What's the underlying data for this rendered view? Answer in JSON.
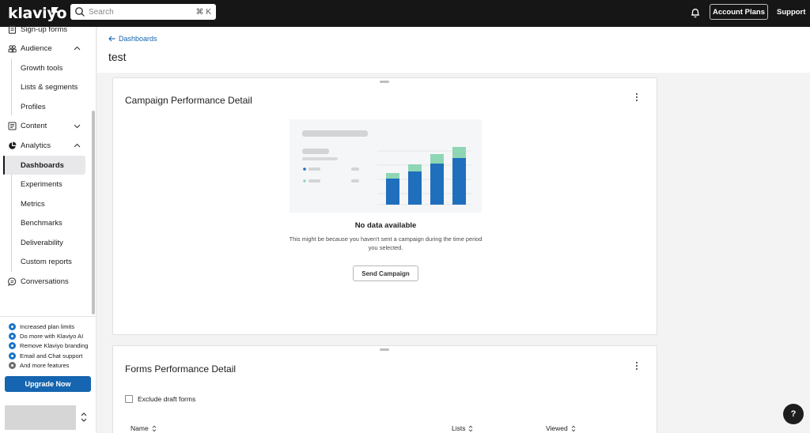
{
  "topbar": {
    "logo": "klaviyo",
    "search_placeholder": "Search",
    "search_shortcut": "⌘ K",
    "account_plans": "Account Plans",
    "support": "Support"
  },
  "sidebar": {
    "items": [
      {
        "label": "Sign-up forms",
        "icon": "form-icon"
      },
      {
        "label": "Audience",
        "icon": "people-icon",
        "expanded": true
      },
      {
        "label": "Content",
        "icon": "content-icon",
        "expanded": false
      },
      {
        "label": "Analytics",
        "icon": "pie-chart-icon",
        "expanded": true
      },
      {
        "label": "Conversations",
        "icon": "chat-icon"
      }
    ],
    "audience_sub": [
      "Growth tools",
      "Lists & segments",
      "Profiles"
    ],
    "analytics_sub": [
      "Dashboards",
      "Experiments",
      "Metrics",
      "Benchmarks",
      "Deliverability",
      "Custom reports"
    ],
    "active_item": "Dashboards",
    "features": [
      "Increased plan limits",
      "Do more with Klaviyo AI",
      "Remove Klaviyo branding",
      "Email and Chat support",
      "And more features"
    ],
    "upgrade_label": "Upgrade Now"
  },
  "header": {
    "back_label": "Dashboards",
    "title": "test"
  },
  "campaign_card": {
    "title": "Campaign Performance Detail",
    "empty_title": "No data available",
    "empty_desc": "This might be because you haven't sent a campaign during the time period you selected.",
    "button_label": "Send Campaign"
  },
  "forms_card": {
    "title": "Forms Performance Detail",
    "checkbox_label": "Exclude draft forms",
    "columns": [
      "Name",
      "Lists",
      "Viewed"
    ]
  },
  "help_label": "?",
  "colors": {
    "topbar": "#161616",
    "accent_blue": "#1565b0",
    "bar_blue": "#1f6fbd",
    "bar_green": "#8fd6b4"
  }
}
